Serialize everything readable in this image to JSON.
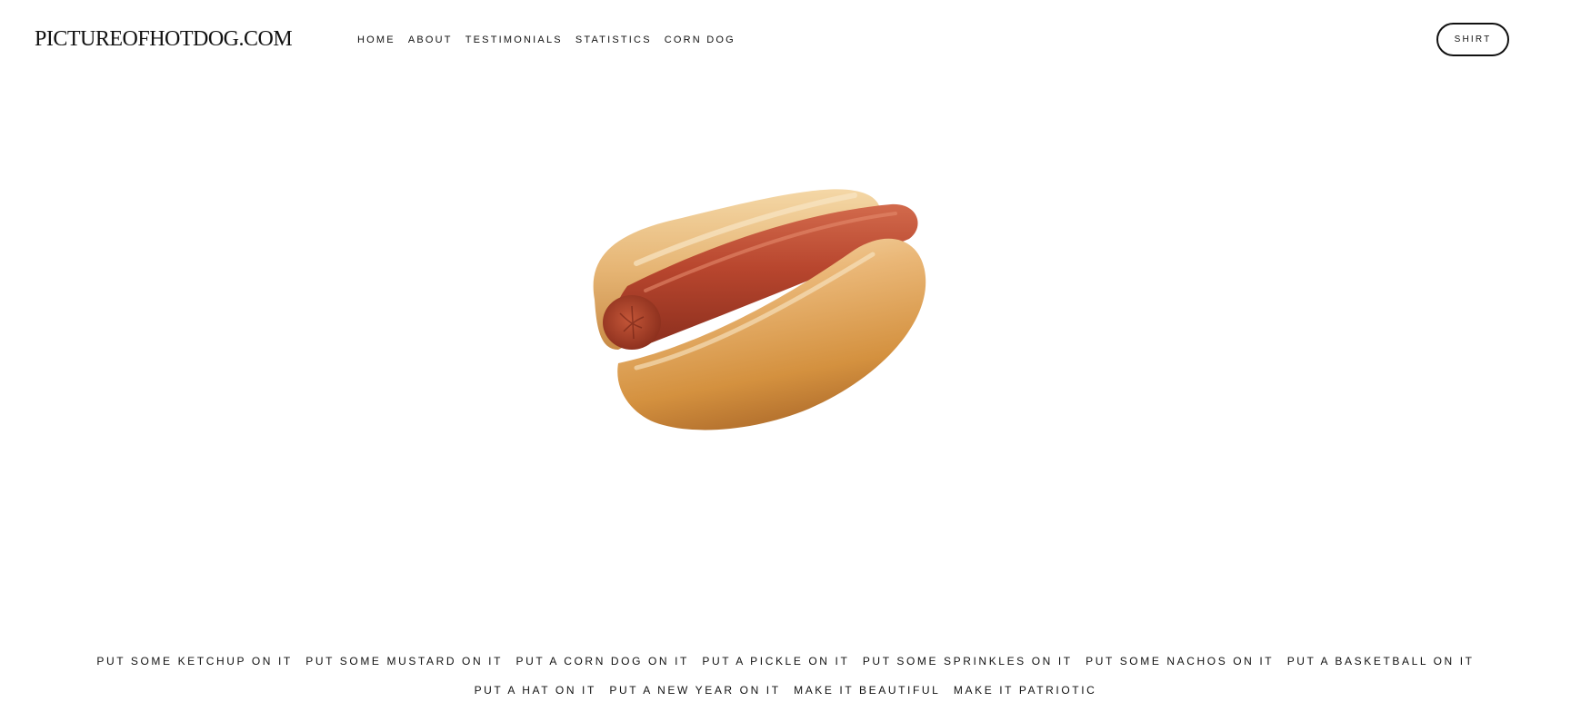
{
  "header": {
    "logo": "PICTUREOFHOTDOG.COM",
    "nav": [
      {
        "label": "HOME"
      },
      {
        "label": "ABOUT"
      },
      {
        "label": "TESTIMONIALS"
      },
      {
        "label": "STATISTICS"
      },
      {
        "label": "CORN DOG"
      }
    ],
    "cta_label": "SHIRT"
  },
  "hero": {
    "image": "hot-dog-in-bun"
  },
  "footer": {
    "links": [
      {
        "label": "PUT SOME KETCHUP ON IT"
      },
      {
        "label": "PUT SOME MUSTARD ON IT"
      },
      {
        "label": "PUT A CORN DOG ON IT"
      },
      {
        "label": "PUT A PICKLE ON IT"
      },
      {
        "label": "PUT SOME SPRINKLES ON IT"
      },
      {
        "label": "PUT SOME NACHOS ON IT"
      },
      {
        "label": "PUT A BASKETBALL ON IT"
      },
      {
        "label": "PUT A HAT ON IT"
      },
      {
        "label": "PUT A NEW YEAR ON IT"
      },
      {
        "label": "MAKE IT BEAUTIFUL"
      },
      {
        "label": "MAKE IT PATRIOTIC"
      }
    ]
  },
  "colors": {
    "text": "#111111",
    "background": "#ffffff",
    "bun": "#e2a256",
    "sausage": "#b4442c"
  }
}
